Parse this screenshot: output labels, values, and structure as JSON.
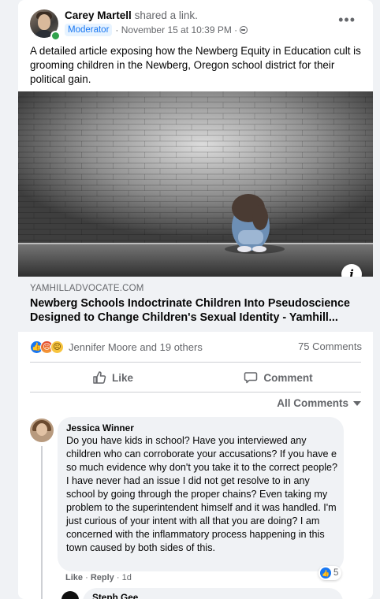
{
  "post": {
    "author": "Carey Martell",
    "action_text": "shared a link.",
    "badge": "Moderator",
    "timestamp": "· November 15 at 10:39 PM ·",
    "body": "A detailed article exposing how the Newberg Equity in Education cult is grooming children in the Newberg, Oregon school district for their political gain."
  },
  "link": {
    "domain": "YAMHILLADVOCATE.COM",
    "title": "Newberg Schools Indoctrinate Children Into Pseudoscience Designed to Change Children's Sexual Identity - Yamhill..."
  },
  "stats": {
    "reactions_text": "Jennifer Moore and 19 others",
    "comments_text": "75 Comments",
    "reaction_icons": [
      "like-icon",
      "angry-icon",
      "sad-icon"
    ]
  },
  "actions": {
    "like_label": "Like",
    "comment_label": "Comment",
    "all_comments_label": "All Comments"
  },
  "comment": {
    "author": "Jessica Winner",
    "text": "Do you have kids in school? Have you interviewed any children who can corroborate your accusations? If you have e so much evidence why don't you take it to the correct people? I have never had an issue I did not get resolve to in any school by going through the proper chains? Even taking my problem to the superintendent himself and it was handled. I'm just curious of your intent with all that you are doing? I am concerned with the inflammatory process happening in this town caused by both sides of this.",
    "reaction_count": "5",
    "like_label": "Like",
    "separator": "·",
    "reply_label": "Reply",
    "age": "1d"
  },
  "reply": {
    "author": "Steph Gee"
  },
  "colors": {
    "accent": "#1877f2",
    "background": "#f0f2f5",
    "secondary_text": "#65676b"
  }
}
